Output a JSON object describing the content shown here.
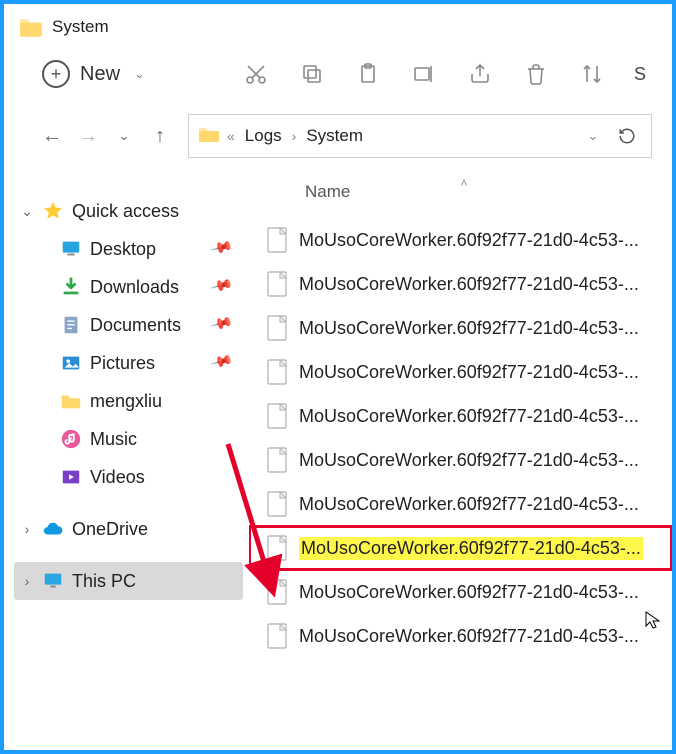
{
  "window": {
    "title": "System"
  },
  "toolbar": {
    "new_label": "New"
  },
  "breadcrumb": {
    "parent": "Logs",
    "current": "System"
  },
  "sidebar": {
    "quick_access": "Quick access",
    "items": [
      {
        "label": "Desktop",
        "icon": "desktop",
        "pinned": true
      },
      {
        "label": "Downloads",
        "icon": "download",
        "pinned": true
      },
      {
        "label": "Documents",
        "icon": "document",
        "pinned": true
      },
      {
        "label": "Pictures",
        "icon": "pictures",
        "pinned": true
      },
      {
        "label": "mengxliu",
        "icon": "folder",
        "pinned": false
      },
      {
        "label": "Music",
        "icon": "music",
        "pinned": false
      },
      {
        "label": "Videos",
        "icon": "videos",
        "pinned": false
      }
    ],
    "onedrive": "OneDrive",
    "this_pc": "This PC"
  },
  "columns": {
    "name": "Name"
  },
  "files": [
    {
      "name": "MoUsoCoreWorker.60f92f77-21d0-4c53-...",
      "highlighted": false
    },
    {
      "name": "MoUsoCoreWorker.60f92f77-21d0-4c53-...",
      "highlighted": false
    },
    {
      "name": "MoUsoCoreWorker.60f92f77-21d0-4c53-...",
      "highlighted": false
    },
    {
      "name": "MoUsoCoreWorker.60f92f77-21d0-4c53-...",
      "highlighted": false
    },
    {
      "name": "MoUsoCoreWorker.60f92f77-21d0-4c53-...",
      "highlighted": false
    },
    {
      "name": "MoUsoCoreWorker.60f92f77-21d0-4c53-...",
      "highlighted": false
    },
    {
      "name": "MoUsoCoreWorker.60f92f77-21d0-4c53-...",
      "highlighted": false
    },
    {
      "name": "MoUsoCoreWorker.60f92f77-21d0-4c53-...",
      "highlighted": true
    },
    {
      "name": "MoUsoCoreWorker.60f92f77-21d0-4c53-...",
      "highlighted": false
    },
    {
      "name": "MoUsoCoreWorker.60f92f77-21d0-4c53-...",
      "highlighted": false
    }
  ]
}
